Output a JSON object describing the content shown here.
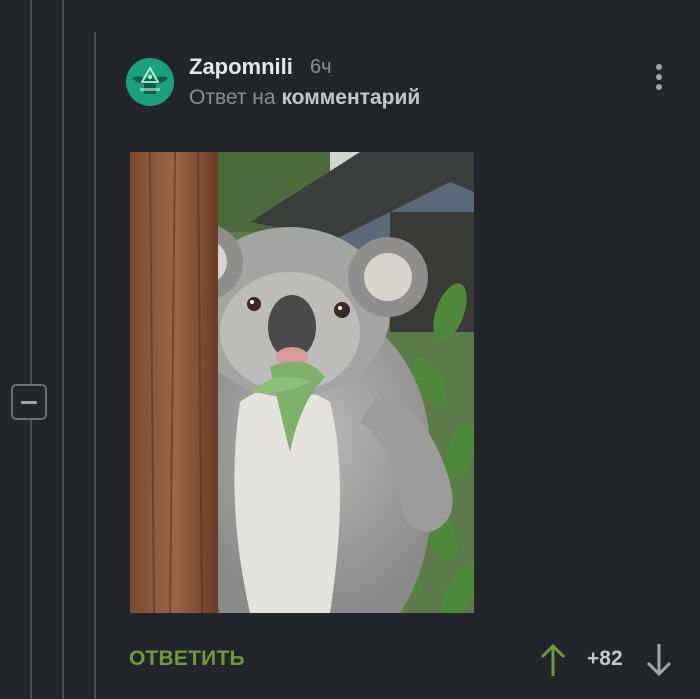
{
  "comment": {
    "author": "Zapomnili",
    "time": "6ч",
    "reply_prefix": "Ответ на",
    "reply_target": "комментарий",
    "image_alt": "Surprised koala eating eucalyptus leaf"
  },
  "actions": {
    "reply_label": "ОТВЕТИТЬ",
    "rating": "+82"
  },
  "colors": {
    "background": "#222529",
    "accent_green": "#6d9a3c",
    "avatar_green": "#1aa07a"
  }
}
